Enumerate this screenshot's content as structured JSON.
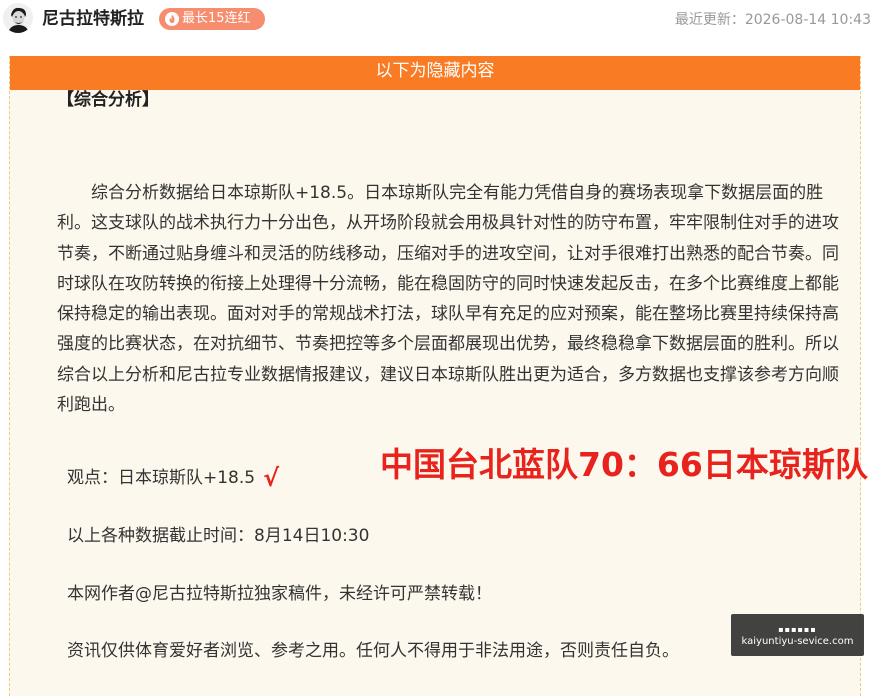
{
  "header": {
    "author_name": "尼古拉特斯拉",
    "streak_badge": "最长15连红",
    "update_time": "最近更新：2026-08-14 10:43"
  },
  "hidden": {
    "bar_label": "以下为隐藏内容"
  },
  "article": {
    "section_title": "【综合分析】",
    "analysis": "综合分析数据给日本琼斯队+18.5。日本琼斯队完全有能力凭借自身的赛场表现拿下数据层面的胜利。这支球队的战术执行力十分出色，从开场阶段就会用极具针对性的防守布置，牢牢限制住对手的进攻节奏，不断通过贴身缠斗和灵活的防线移动，压缩对手的进攻空间，让对手很难打出熟悉的配合节奏。同时球队在攻防转换的衔接上处理得十分流畅，能在稳固防守的同时快速发起反击，在多个比赛维度上都能保持稳定的输出表现。面对对手的常规战术打法，球队早有充足的应对预案，能在整场比赛里持续保持高强度的比赛状态，在对抗细节、节奏把控等多个层面都展现出优势，最终稳稳拿下数据层面的胜利。所以综合以上分析和尼古拉专业数据情报建议，建议日本琼斯队胜出更为适合，多方数据也支撑该参考方向顺利跑出。",
    "viewpoint": "观点：日本琼斯队+18.5",
    "check": "√",
    "score_line": "中国台北蓝队70：66日本琼斯队",
    "cutoff": "以上各种数据截止时间：8月14日10:30",
    "copyright": "本网作者@尼古拉特斯拉独家稿件，未经许可严禁转载！",
    "disclaimer": "资讯仅供体育爱好者浏览、参考之用。任何人不得用于非法用途，否则责任自负。"
  },
  "watermark": {
    "top": "▪▪▪▪▪▪",
    "url": "kaiyuntiyu-sevice.com"
  },
  "colors": {
    "accent_orange": "#f97c24",
    "badge": "#f68d6e",
    "highlight_red": "#e8221c",
    "box_bg": "#fdf8ed"
  },
  "icons": {
    "avatar": "tesla-portrait-avatar",
    "badge": "flame-icon"
  }
}
